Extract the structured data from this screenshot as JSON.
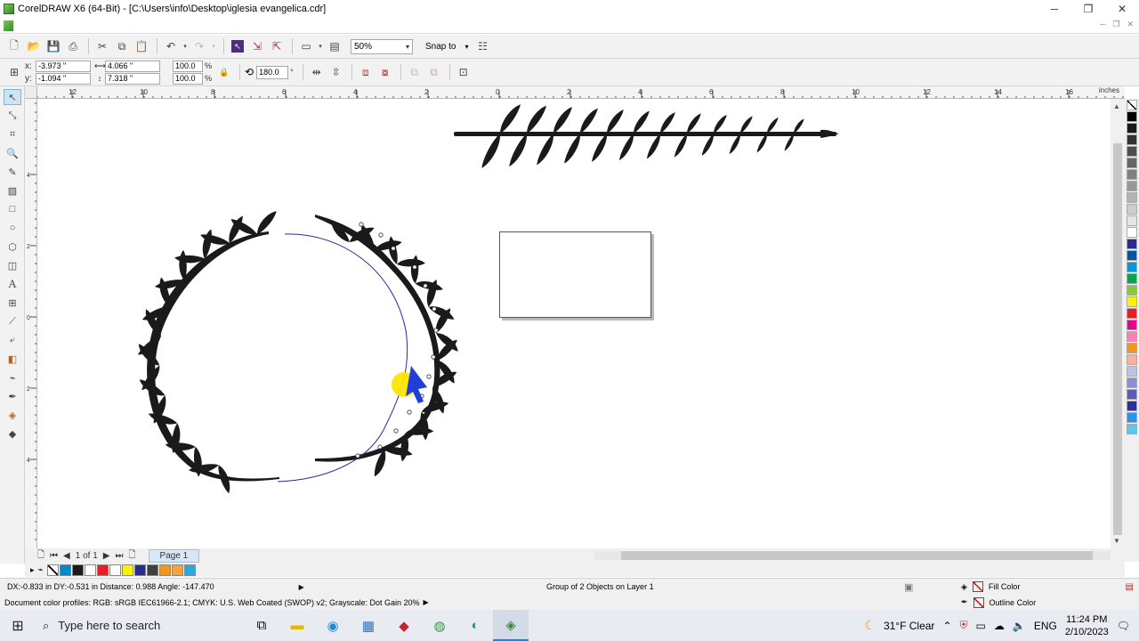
{
  "window": {
    "title": "CorelDRAW X6 (64-Bit) - [C:\\Users\\info\\Desktop\\iglesia evangelica.cdr]",
    "minimize_icon": "minimize-icon",
    "maximize_icon": "restore-icon",
    "close_icon": "close-icon",
    "min_glyph": "─",
    "max_glyph": "❐",
    "close_glyph": "✕"
  },
  "standard_toolbar": {
    "zoom_level": "50%",
    "snap_to_label": "Snap to"
  },
  "property_bar": {
    "x_label": "x:",
    "y_label": "y:",
    "x_value": "-3.973 \"",
    "y_value": "-1.094 \"",
    "width_value": "4.066 \"",
    "height_value": "7.318 \"",
    "scale_x": "100.0",
    "scale_y": "100.0",
    "percent_sign": "%",
    "rotation": "180.0",
    "degree_sign": "°"
  },
  "ruler": {
    "units": "inches",
    "h_ticks": [
      "12",
      "10",
      "8",
      "6",
      "4",
      "2",
      "0",
      "2",
      "4",
      "6",
      "8",
      "10",
      "12",
      "14",
      "16"
    ],
    "v_ticks": [
      "4",
      "2",
      "0",
      "2",
      "4"
    ]
  },
  "page_nav": {
    "page_counter": "1 of 1",
    "page_tab": "Page 1"
  },
  "status": {
    "cursor_info": "DX:-0.833 in DY:-0.531 in Distance: 0.988 Angle: -147.470",
    "selection_info": "Group of 2 Objects on Layer 1",
    "color_profiles": "Document color profiles: RGB: sRGB IEC61966-2.1; CMYK: U.S. Web Coated (SWOP) v2; Grayscale: Dot Gain 20%",
    "fill_label": "Fill Color",
    "outline_label": "Outline Color"
  },
  "palette_colors": [
    "#000000",
    "#1a1a1a",
    "#333333",
    "#4d4d4d",
    "#666666",
    "#808080",
    "#999999",
    "#b3b3b3",
    "#cccccc",
    "#e6e6e6",
    "#ffffff",
    "#2b2b8c",
    "#0055a5",
    "#0099dd",
    "#00a651",
    "#8dc63f",
    "#fff200",
    "#ed1c24",
    "#ec008c",
    "#ff7fb6",
    "#f7941d",
    "#fbb09b",
    "#c1c1e6",
    "#8f8fd0",
    "#5b5bb8",
    "#2e2ea0",
    "#2196f3",
    "#5ec6ee"
  ],
  "doc_palette_colors": [
    "#0088cc",
    "#1a1a1a",
    "#ffffff",
    "#ed1c24",
    "#ffffff",
    "#fff200",
    "#2b2b8c",
    "#404040",
    "#f7941d",
    "#f4a43a",
    "#29abe2"
  ],
  "taskbar": {
    "search_placeholder": "Type here to search",
    "weather": "31°F  Clear",
    "language": "ENG",
    "time": "11:24 PM",
    "date": "2/10/2023"
  }
}
